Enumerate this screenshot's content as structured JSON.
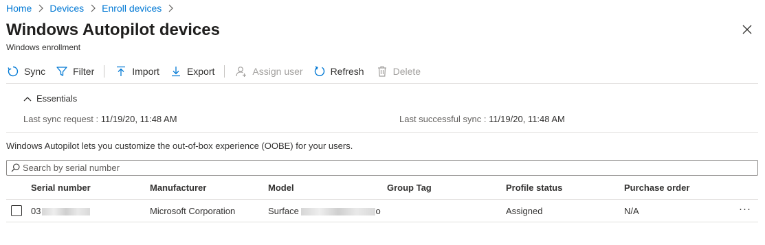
{
  "breadcrumb": {
    "items": [
      {
        "label": "Home"
      },
      {
        "label": "Devices"
      },
      {
        "label": "Enroll devices"
      }
    ]
  },
  "page": {
    "title": "Windows Autopilot devices",
    "subtitle": "Windows enrollment"
  },
  "toolbar": {
    "sync": "Sync",
    "filter": "Filter",
    "import": "Import",
    "export": "Export",
    "assign_user": "Assign user",
    "refresh": "Refresh",
    "delete": "Delete"
  },
  "essentials": {
    "label": "Essentials",
    "last_sync_request_label": "Last sync request",
    "last_sync_request_value": "11/19/20, 11:48 AM",
    "last_successful_sync_label": "Last successful sync",
    "last_successful_sync_value": "11/19/20, 11:48 AM"
  },
  "info_text": "Windows Autopilot lets you customize the out-of-box experience (OOBE) for your users.",
  "search": {
    "placeholder": "Search by serial number",
    "value": ""
  },
  "table": {
    "columns": [
      "Serial number",
      "Manufacturer",
      "Model",
      "Group Tag",
      "Profile status",
      "Purchase order"
    ],
    "rows": [
      {
        "serial_prefix": "03",
        "manufacturer": "Microsoft Corporation",
        "model_prefix": "Surface",
        "model_suffix": "o",
        "group_tag": "",
        "profile_status": "Assigned",
        "purchase_order": "N/A",
        "more": "···"
      }
    ]
  },
  "colors": {
    "accent": "#0078d4",
    "text": "#323130",
    "disabled": "#a19f9d",
    "divider": "#e1dfdd"
  },
  "icons": [
    "chevron-right-icon",
    "close-icon",
    "sync-icon",
    "filter-icon",
    "import-icon",
    "export-icon",
    "assign-user-icon",
    "refresh-icon",
    "delete-icon",
    "chevron-up-icon",
    "search-icon"
  ]
}
